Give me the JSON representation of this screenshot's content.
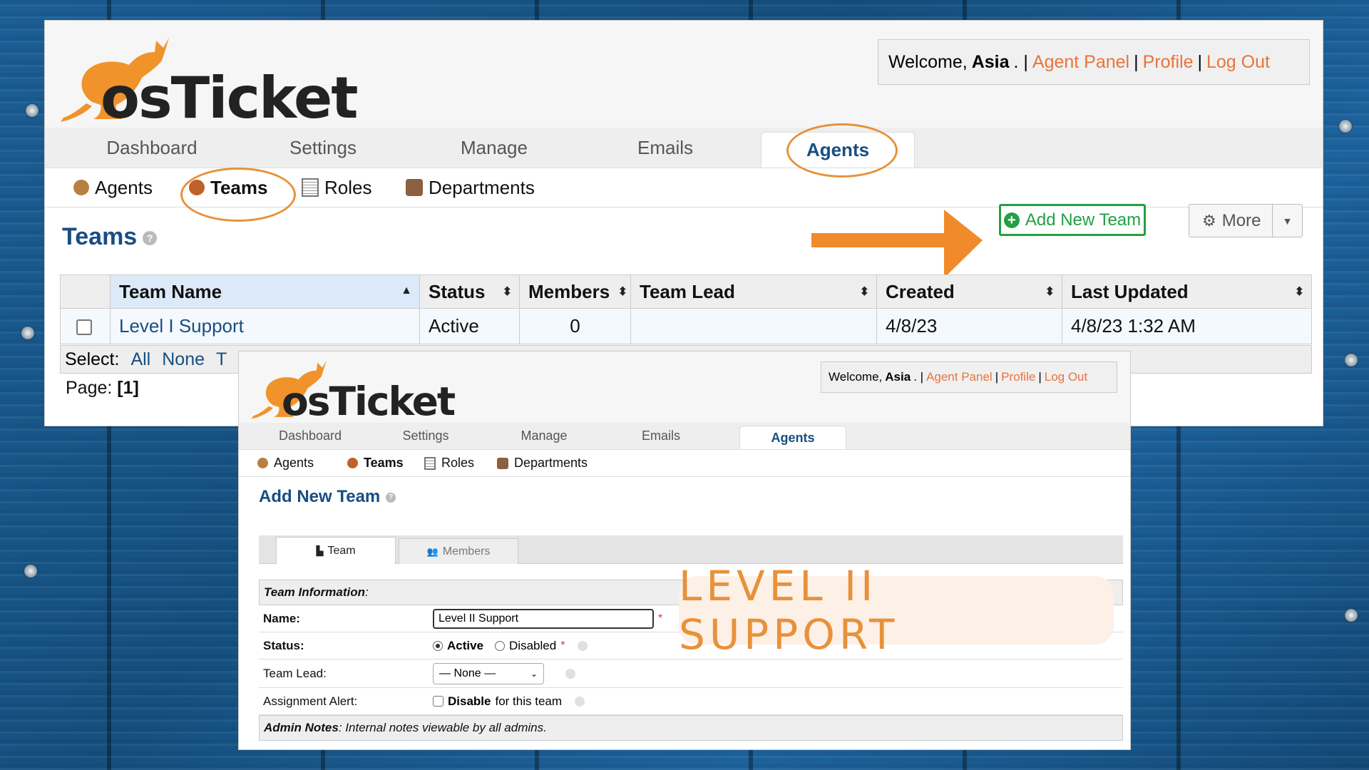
{
  "brand": {
    "logo_text": "osTicket"
  },
  "top": {
    "welcome_prefix": "Welcome,",
    "user": "Asia",
    "welcome_suffix": ". |",
    "agent_panel": "Agent Panel",
    "sep1": "|",
    "profile": "Profile",
    "sep2": "|",
    "logout": "Log Out"
  },
  "nav": {
    "tabs": [
      "Dashboard",
      "Settings",
      "Manage",
      "Emails",
      "Agents"
    ],
    "active": "Agents"
  },
  "subnav": {
    "items": [
      "Agents",
      "Teams",
      "Roles",
      "Departments"
    ],
    "active": "Teams"
  },
  "teams_page": {
    "title": "Teams",
    "help": "?",
    "add_button": "Add New Team",
    "more_button": "More",
    "table": {
      "headers": [
        "Team Name",
        "Status",
        "Members",
        "Team Lead",
        "Created",
        "Last Updated"
      ],
      "rows": [
        {
          "name": "Level I Support",
          "status": "Active",
          "members": "0",
          "lead": "",
          "created": "4/8/23",
          "updated": "4/8/23 1:32 AM"
        }
      ]
    },
    "select_label": "Select:",
    "select_all": "All",
    "select_none": "None",
    "select_toggle": "T",
    "page_label": "Page:",
    "page_value": "[1]"
  },
  "add_team": {
    "title": "Add New Team",
    "tab_team": "Team",
    "tab_members": "Members",
    "section_info": "Team Information",
    "section_info_colon": ":",
    "name_label": "Name:",
    "name_value": "Level II Support",
    "status_label": "Status:",
    "status_active": "Active",
    "status_disabled": "Disabled",
    "lead_label": "Team Lead:",
    "lead_value": "— None —",
    "alert_label": "Assignment Alert:",
    "alert_disable": "Disable",
    "alert_suffix": "for this team",
    "admin_notes_label": "Admin Notes",
    "admin_notes_text": ": Internal notes viewable by all admins.",
    "required_mark": "*"
  },
  "overlay": {
    "text": "LEVEL II SUPPORT"
  },
  "colors": {
    "brand_orange": "#e8913b",
    "link_blue": "#184e81",
    "add_green": "#22a043",
    "background_blue": "#1b5e96"
  }
}
